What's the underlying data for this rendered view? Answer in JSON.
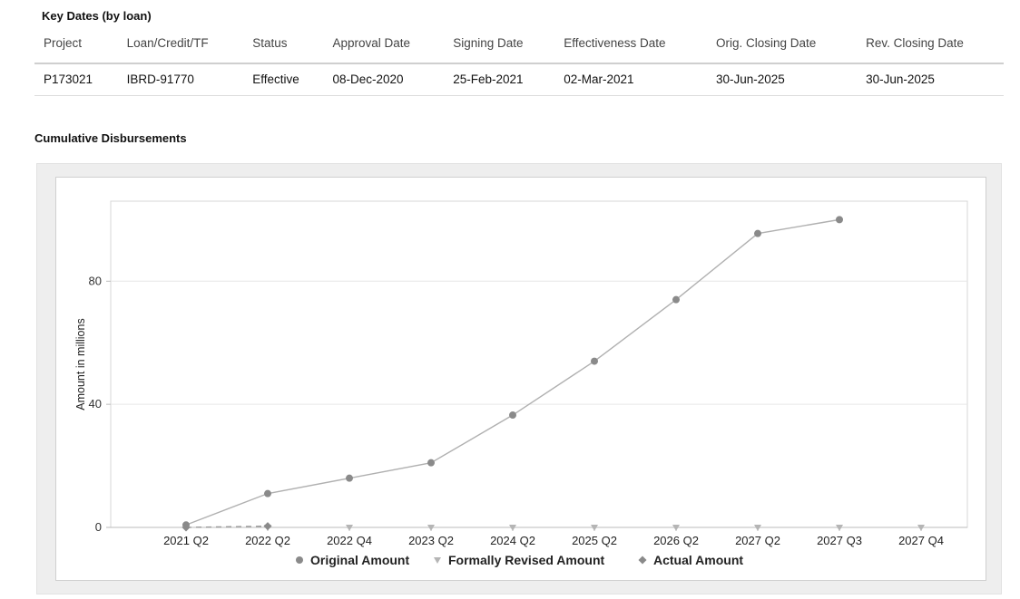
{
  "key_dates": {
    "title": "Key Dates (by loan)",
    "columns": [
      "Project",
      "Loan/Credit/TF",
      "Status",
      "Approval Date",
      "Signing Date",
      "Effectiveness Date",
      "Orig. Closing Date",
      "Rev. Closing Date"
    ],
    "rows": [
      [
        "P173021",
        "IBRD-91770",
        "Effective",
        "08-Dec-2020",
        "25-Feb-2021",
        "02-Mar-2021",
        "30-Jun-2025",
        "30-Jun-2025"
      ]
    ]
  },
  "disbursements": {
    "title": "Cumulative Disbursements"
  },
  "chart_data": {
    "type": "line",
    "title": "",
    "xlabel": "",
    "ylabel": "Amount in millions",
    "ylim": [
      0,
      106
    ],
    "yticks": [
      0,
      40,
      80
    ],
    "categories": [
      "2021 Q2",
      "2022 Q2",
      "2022 Q4",
      "2023 Q2",
      "2024 Q2",
      "2025 Q2",
      "2026 Q2",
      "2027 Q2",
      "2027 Q3",
      "2027 Q4"
    ],
    "grid": true,
    "legend_position": "bottom",
    "series": [
      {
        "name": "Original Amount",
        "marker": "circle",
        "color": "#8a8a8a",
        "values": [
          0.8,
          11,
          16,
          21,
          36.5,
          54,
          74,
          95.5,
          100,
          null
        ]
      },
      {
        "name": "Formally Revised Amount",
        "marker": "triangle-down",
        "color": "#b5b5b5",
        "values": [
          0,
          0,
          0,
          0,
          0,
          0,
          0,
          0,
          0,
          0
        ]
      },
      {
        "name": "Actual Amount",
        "marker": "diamond",
        "color": "#8a8a8a",
        "values": [
          0,
          0.4
        ]
      }
    ]
  }
}
